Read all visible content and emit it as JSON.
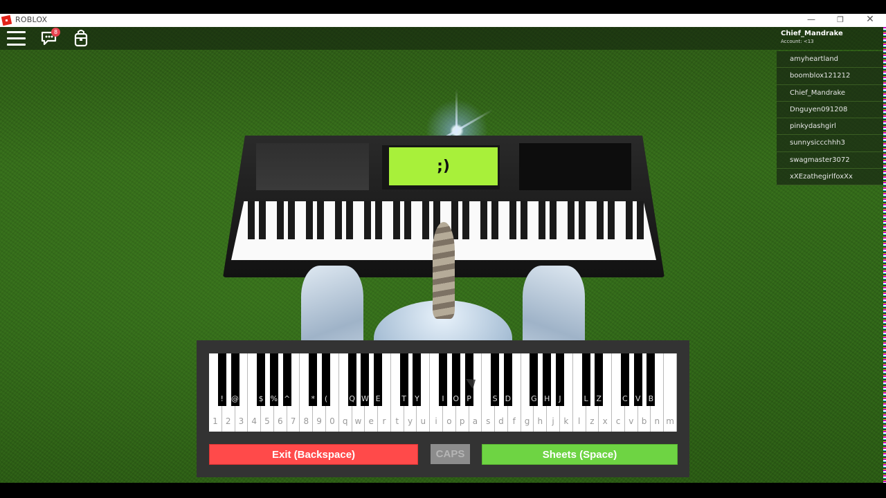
{
  "window": {
    "title": "ROBLOX",
    "controls": {
      "minimize": "—",
      "maximize": "❐",
      "close": "✕"
    }
  },
  "topbar": {
    "menu_icon": "hamburger-menu-icon",
    "chat_icon": "chat-bubble-icon",
    "chat_badge": "8",
    "backpack_icon": "backpack-icon"
  },
  "player": {
    "name": "Chief_Mandrake",
    "account": "Account: <13"
  },
  "player_list": [
    "amyheartland",
    "boomblox121212",
    "Chief_Mandrake",
    "Dnguyen091208",
    "pinkydashgirl",
    "sunnysiccchhh3",
    "swagmaster3072",
    "xXEzathegirlfoxXx"
  ],
  "scene": {
    "piano_display_text": ";)"
  },
  "keyboard": {
    "white_keys": [
      "1",
      "2",
      "3",
      "4",
      "5",
      "6",
      "7",
      "8",
      "9",
      "0",
      "q",
      "w",
      "e",
      "r",
      "t",
      "y",
      "u",
      "i",
      "o",
      "p",
      "a",
      "s",
      "d",
      "f",
      "g",
      "h",
      "j",
      "k",
      "l",
      "z",
      "x",
      "c",
      "v",
      "b",
      "n",
      "m"
    ],
    "black_keys": [
      "!",
      "@",
      "",
      "$",
      "%",
      "^",
      "",
      "*",
      "(",
      "",
      "Q",
      "W",
      "E",
      "",
      "T",
      "Y",
      "",
      "I",
      "O",
      "P",
      "",
      "S",
      "D",
      "",
      "G",
      "H",
      "J",
      "",
      "L",
      "Z",
      "",
      "C",
      "V",
      "B",
      "",
      ""
    ]
  },
  "buttons": {
    "exit": "Exit (Backspace)",
    "caps": "CAPS",
    "sheets": "Sheets (Space)"
  },
  "colors": {
    "exit": "#ff4a4a",
    "sheets": "#6ed443",
    "caps": "#8c8c8c",
    "lcd": "#a8f03a",
    "gui_panel": "#333333",
    "badge": "#e8424f"
  }
}
